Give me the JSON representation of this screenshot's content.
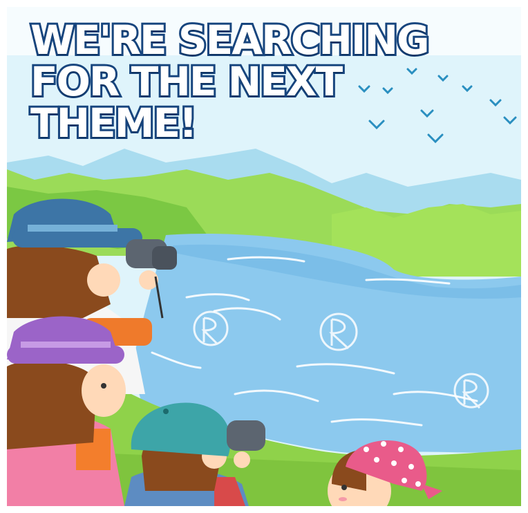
{
  "headline": {
    "line1": "WE'RE SEARCHING",
    "line2": "FOR  THE NEXT",
    "line3": "THEME!"
  },
  "colors": {
    "headline_fill": "#ffffff",
    "headline_outline": "#17457e",
    "sky": "#dff4fb",
    "river": "#8cc9ee",
    "grass": "#8fd24a",
    "mountains": "#a9dcef"
  },
  "illustration": {
    "subject": "children birdwatching by a river",
    "icons": [
      "bird-icon",
      "binoculars-icon",
      "watermark-r-icon"
    ]
  }
}
